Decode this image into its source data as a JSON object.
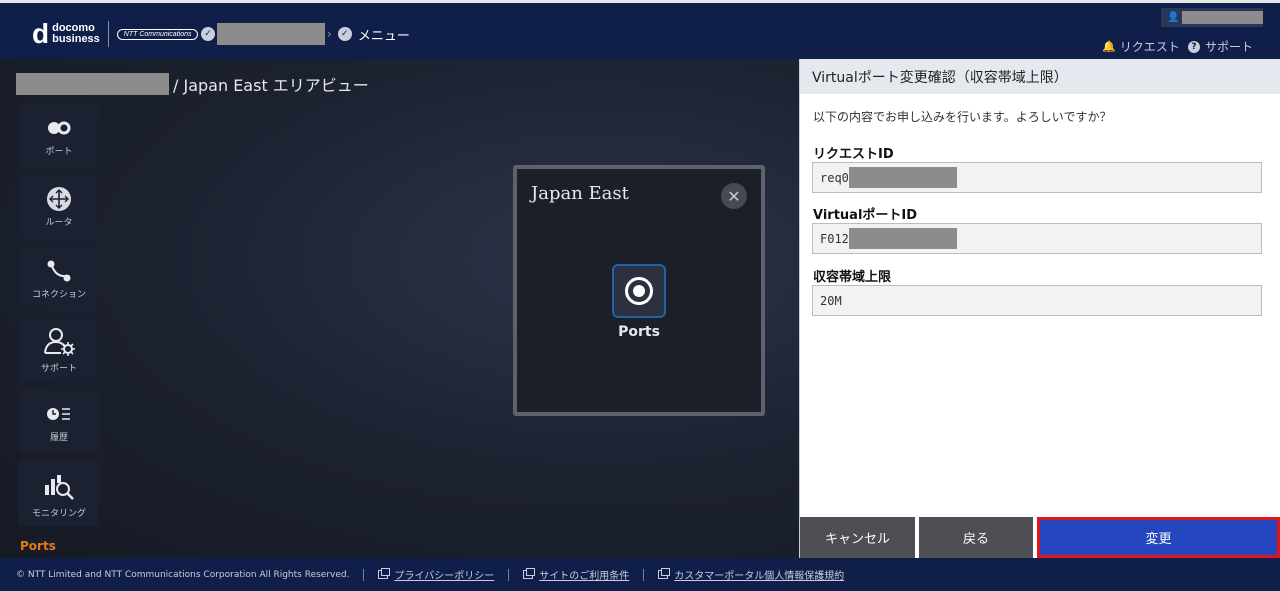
{
  "header": {
    "logo_d": "d",
    "logo_line1": "docomo",
    "logo_line2": "business",
    "logo_ntt": "NTT Communications",
    "menu_label": "メニュー",
    "request_label": "リクエスト",
    "support_label": "サポート"
  },
  "area": {
    "title_suffix": "/ Japan East エリアビュー"
  },
  "sidebar": {
    "items": [
      {
        "label": "ポート",
        "icon": "ports-icon"
      },
      {
        "label": "ルータ",
        "icon": "router-icon"
      },
      {
        "label": "コネクション",
        "icon": "connection-icon"
      },
      {
        "label": "サポート",
        "icon": "support-icon"
      },
      {
        "label": "履歴",
        "icon": "history-icon"
      },
      {
        "label": "モニタリング",
        "icon": "monitoring-icon"
      }
    ],
    "active_section": "Ports"
  },
  "region_card": {
    "title": "Japan East",
    "port_label": "Ports"
  },
  "panel": {
    "title": "Virtualポート変更確認（収容帯域上限）",
    "message": "以下の内容でお申し込みを行います。よろしいですか？",
    "fields": [
      {
        "label": "リクエストID",
        "value": "req0"
      },
      {
        "label": "VirtualポートID",
        "value": "F012"
      },
      {
        "label": "収容帯域上限",
        "value": "20M"
      }
    ],
    "buttons": {
      "cancel": "キャンセル",
      "back": "戻る",
      "change": "変更"
    }
  },
  "footer": {
    "copyright": "© NTT Limited and NTT Communications Corporation All Rights Reserved.",
    "links": [
      "プライバシーポリシー",
      "サイトのご利用条件",
      "カスタマーポータル個人情報保護規約"
    ]
  },
  "colors": {
    "header_bg": "#0f1f4a",
    "accent_orange": "#e8761e",
    "primary_button": "#2447c0",
    "highlight_border": "#e0141b"
  }
}
